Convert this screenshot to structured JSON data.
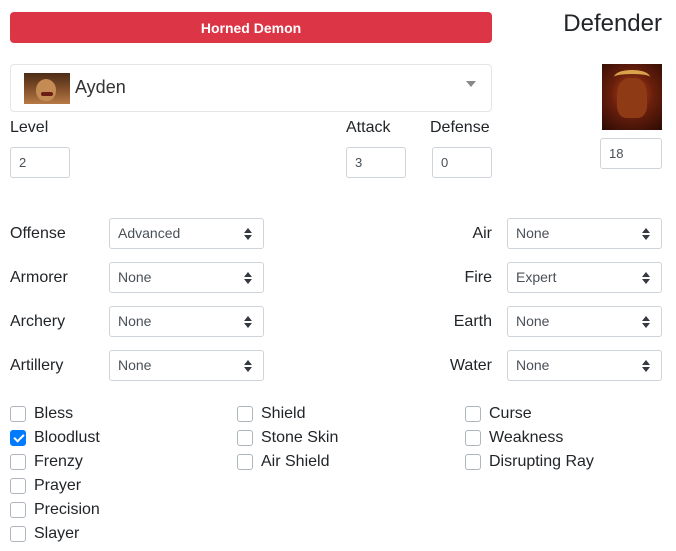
{
  "unit": {
    "name": "Horned Demon",
    "color": "#dc3545"
  },
  "side_title": "Defender",
  "hero": {
    "name": "Ayden"
  },
  "stats": {
    "level_label": "Level",
    "level_value": "2",
    "attack_label": "Attack",
    "attack_value": "3",
    "defense_label": "Defense",
    "defense_value": "0",
    "count_value": "18"
  },
  "skills_left": [
    {
      "label": "Offense",
      "value": "Advanced"
    },
    {
      "label": "Armorer",
      "value": "None"
    },
    {
      "label": "Archery",
      "value": "None"
    },
    {
      "label": "Artillery",
      "value": "None"
    }
  ],
  "skills_right": [
    {
      "label": "Air",
      "value": "None"
    },
    {
      "label": "Fire",
      "value": "Expert"
    },
    {
      "label": "Earth",
      "value": "None"
    },
    {
      "label": "Water",
      "value": "None"
    }
  ],
  "spells": {
    "col1": [
      {
        "label": "Bless",
        "checked": false
      },
      {
        "label": "Bloodlust",
        "checked": true
      },
      {
        "label": "Frenzy",
        "checked": false
      },
      {
        "label": "Prayer",
        "checked": false
      },
      {
        "label": "Precision",
        "checked": false
      },
      {
        "label": "Slayer",
        "checked": false
      }
    ],
    "col2": [
      {
        "label": "Shield",
        "checked": false
      },
      {
        "label": "Stone Skin",
        "checked": false
      },
      {
        "label": "Air Shield",
        "checked": false
      }
    ],
    "col3": [
      {
        "label": "Curse",
        "checked": false
      },
      {
        "label": "Weakness",
        "checked": false
      },
      {
        "label": "Disrupting Ray",
        "checked": false
      }
    ]
  },
  "checkbox_color": "#007bff"
}
